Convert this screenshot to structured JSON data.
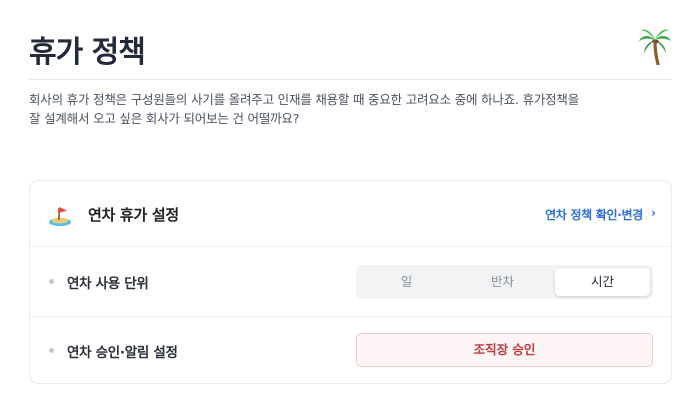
{
  "header": {
    "title": "휴가 정책",
    "icon": "palm-tree-icon"
  },
  "description": {
    "line1": "회사의 휴가 정책은 구성원들의 사기를 올려주고 인재를 채용할 때 중요한 고려요소 중에 하나죠. 휴가정책을",
    "line2": "잘 설계해서 오고 싶은 회사가 되어보는 건 어떨까요?"
  },
  "card": {
    "icon": "island-icon",
    "title": "연차 휴가 설정",
    "link_label": "연차 정책 확인·변경",
    "link_chevron": "›",
    "rows": [
      {
        "label": "연차 사용 단위",
        "options": [
          "일",
          "반차",
          "시간"
        ],
        "selected": "시간"
      },
      {
        "label": "연차 승인·알림 설정",
        "button_label": "조직장 승인"
      }
    ]
  },
  "colors": {
    "accent_blue": "#2a6fd8",
    "alert_red": "#c23b3b",
    "alert_bg": "#fdf5f5"
  }
}
